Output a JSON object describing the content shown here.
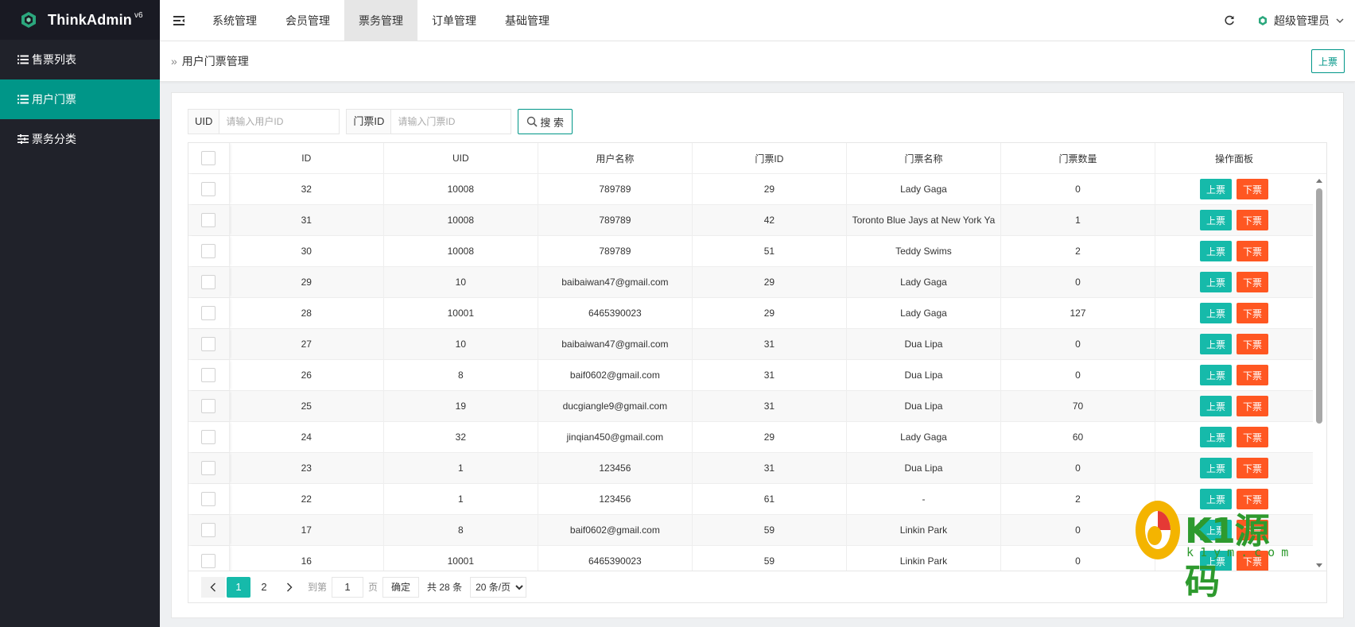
{
  "app": {
    "logo_text": "ThinkAdmin",
    "logo_version": "v6"
  },
  "sidebar": {
    "items": [
      {
        "label": "售票列表",
        "active": false,
        "icon": "list-icon"
      },
      {
        "label": "用户门票",
        "active": true,
        "icon": "list-icon"
      },
      {
        "label": "票务分类",
        "active": false,
        "icon": "sliders-icon"
      }
    ]
  },
  "topbar": {
    "tabs": [
      {
        "label": "系统管理",
        "active": false
      },
      {
        "label": "会员管理",
        "active": false
      },
      {
        "label": "票务管理",
        "active": true
      },
      {
        "label": "订单管理",
        "active": false
      },
      {
        "label": "基础管理",
        "active": false
      }
    ],
    "user_label": "超级管理员"
  },
  "breadcrumb": {
    "title": "用户门票管理",
    "action_label": "上票"
  },
  "search": {
    "uid_label": "UID",
    "uid_placeholder": "请输入用户ID",
    "ticket_label": "门票ID",
    "ticket_placeholder": "请输入门票ID",
    "button_label": "搜 索"
  },
  "table": {
    "headers": [
      "ID",
      "UID",
      "用户名称",
      "门票ID",
      "门票名称",
      "门票数量",
      "操作面板"
    ],
    "btn_up": "上票",
    "btn_down": "下票",
    "rows": [
      {
        "id": "32",
        "uid": "10008",
        "username": "789789",
        "ticket_id": "29",
        "ticket_name": "Lady Gaga",
        "qty": "0"
      },
      {
        "id": "31",
        "uid": "10008",
        "username": "789789",
        "ticket_id": "42",
        "ticket_name": "Toronto Blue Jays at New York Ya",
        "qty": "1"
      },
      {
        "id": "30",
        "uid": "10008",
        "username": "789789",
        "ticket_id": "51",
        "ticket_name": "Teddy Swims",
        "qty": "2"
      },
      {
        "id": "29",
        "uid": "10",
        "username": "baibaiwan47@gmail.com",
        "ticket_id": "29",
        "ticket_name": "Lady Gaga",
        "qty": "0"
      },
      {
        "id": "28",
        "uid": "10001",
        "username": "6465390023",
        "ticket_id": "29",
        "ticket_name": "Lady Gaga",
        "qty": "127"
      },
      {
        "id": "27",
        "uid": "10",
        "username": "baibaiwan47@gmail.com",
        "ticket_id": "31",
        "ticket_name": "Dua Lipa",
        "qty": "0"
      },
      {
        "id": "26",
        "uid": "8",
        "username": "baif0602@gmail.com",
        "ticket_id": "31",
        "ticket_name": "Dua Lipa",
        "qty": "0"
      },
      {
        "id": "25",
        "uid": "19",
        "username": "ducgiangle9@gmail.com",
        "ticket_id": "31",
        "ticket_name": "Dua Lipa",
        "qty": "70"
      },
      {
        "id": "24",
        "uid": "32",
        "username": "jinqian450@gmail.com",
        "ticket_id": "29",
        "ticket_name": "Lady Gaga",
        "qty": "60"
      },
      {
        "id": "23",
        "uid": "1",
        "username": "123456",
        "ticket_id": "31",
        "ticket_name": "Dua Lipa",
        "qty": "0"
      },
      {
        "id": "22",
        "uid": "1",
        "username": "123456",
        "ticket_id": "61",
        "ticket_name": "-",
        "qty": "2"
      },
      {
        "id": "17",
        "uid": "8",
        "username": "baif0602@gmail.com",
        "ticket_id": "59",
        "ticket_name": "Linkin Park",
        "qty": "0"
      },
      {
        "id": "16",
        "uid": "10001",
        "username": "6465390023",
        "ticket_id": "59",
        "ticket_name": "Linkin Park",
        "qty": "0"
      }
    ]
  },
  "pager": {
    "pages": [
      "1",
      "2"
    ],
    "current": "1",
    "goto_label": "到第",
    "goto_value": "1",
    "page_unit": "页",
    "confirm_label": "确定",
    "total_label": "共 28 条",
    "page_size": "20 条/页"
  },
  "watermark": {
    "text": "K1源码",
    "sub": "k1ym.com"
  },
  "colors": {
    "sidebar_bg": "#20222a",
    "accent": "#009688",
    "btn_up": "#16baaa",
    "btn_down": "#ff5722"
  }
}
